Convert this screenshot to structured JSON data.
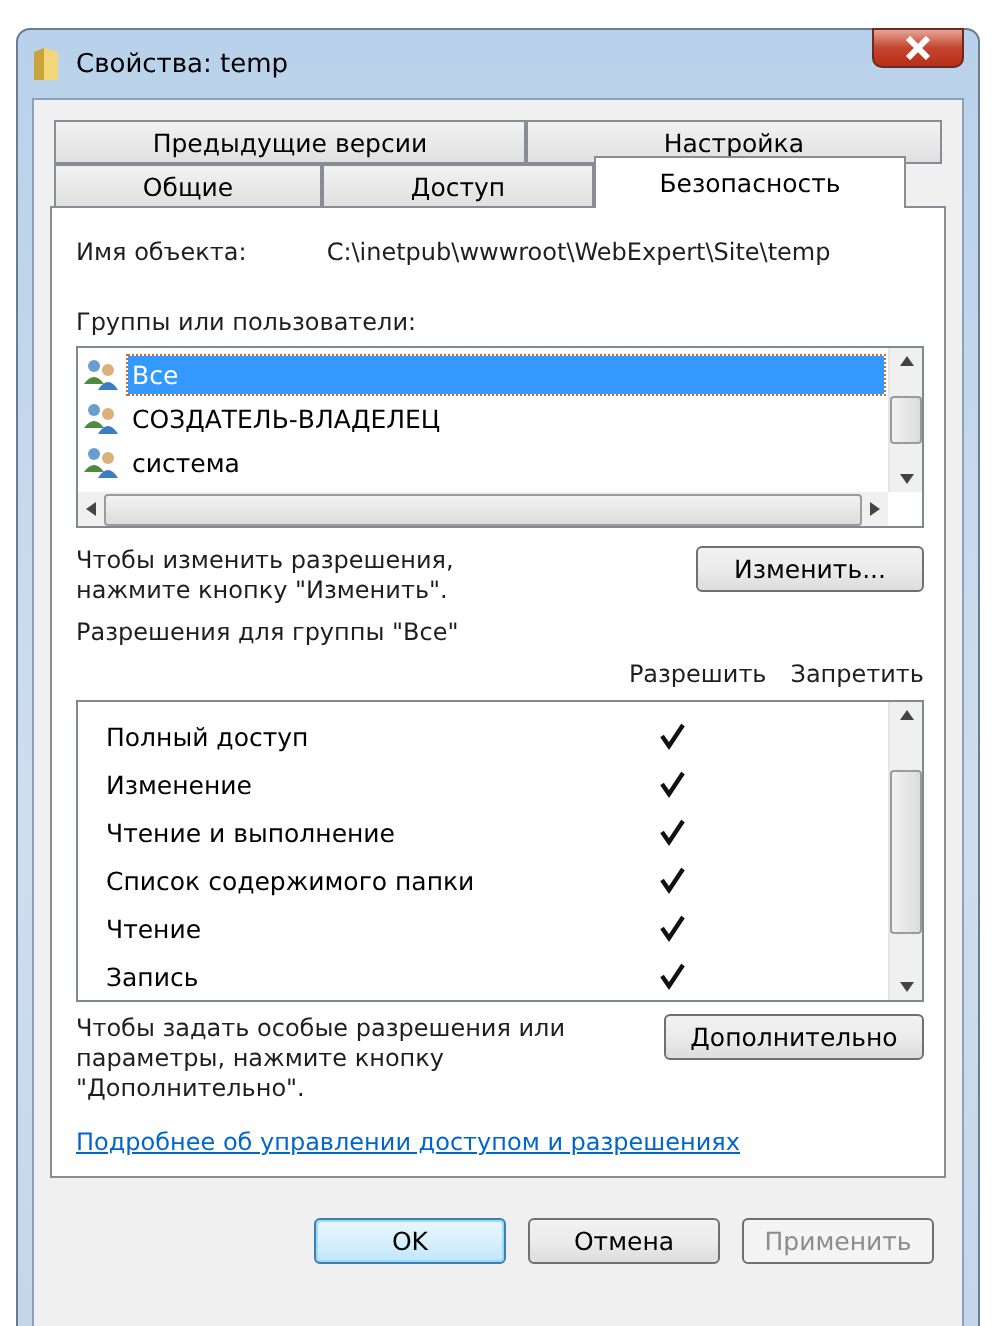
{
  "window": {
    "title": "Свойства: temp"
  },
  "tabs": [
    [
      {
        "label": "Предыдущие версии",
        "selected": false
      },
      {
        "label": "Настройка",
        "selected": false
      }
    ],
    [
      {
        "label": "Общие",
        "selected": false
      },
      {
        "label": "Доступ",
        "selected": false
      },
      {
        "label": "Безопасность",
        "selected": true
      }
    ]
  ],
  "object": {
    "label": "Имя объекта:",
    "value": "C:\\inetpub\\wwwroot\\WebExpert\\Site\\temp"
  },
  "groups": {
    "label": "Группы или пользователи:",
    "items": [
      {
        "name": "Все",
        "selected": true
      },
      {
        "name": "СОЗДАТЕЛЬ-ВЛАДЕЛЕЦ",
        "selected": false
      },
      {
        "name": "система",
        "selected": false
      }
    ]
  },
  "change_hint": "Чтобы изменить разрешения,\nнажмите кнопку \"Изменить\".",
  "change_button": "Изменить...",
  "permissions": {
    "label": "Разрешения для группы \"Все\"",
    "columns": [
      "Разрешить",
      "Запретить"
    ],
    "rows": [
      {
        "name": "Полный доступ",
        "allow": true
      },
      {
        "name": "Изменение",
        "allow": true
      },
      {
        "name": "Чтение и выполнение",
        "allow": true
      },
      {
        "name": "Список содержимого папки",
        "allow": true
      },
      {
        "name": "Чтение",
        "allow": true
      },
      {
        "name": "Запись",
        "allow": true
      }
    ]
  },
  "advanced_hint": "Чтобы задать особые разрешения или\nпараметры, нажмите кнопку\n\"Дополнительно\".",
  "advanced_button": "Дополнительно",
  "link": "Подробнее об управлении доступом и разрешениях",
  "buttons": [
    {
      "label": "OK",
      "disabled": false,
      "default": true
    },
    {
      "label": "Отмена",
      "disabled": false,
      "default": false
    },
    {
      "label": "Применить",
      "disabled": true,
      "default": false
    }
  ]
}
